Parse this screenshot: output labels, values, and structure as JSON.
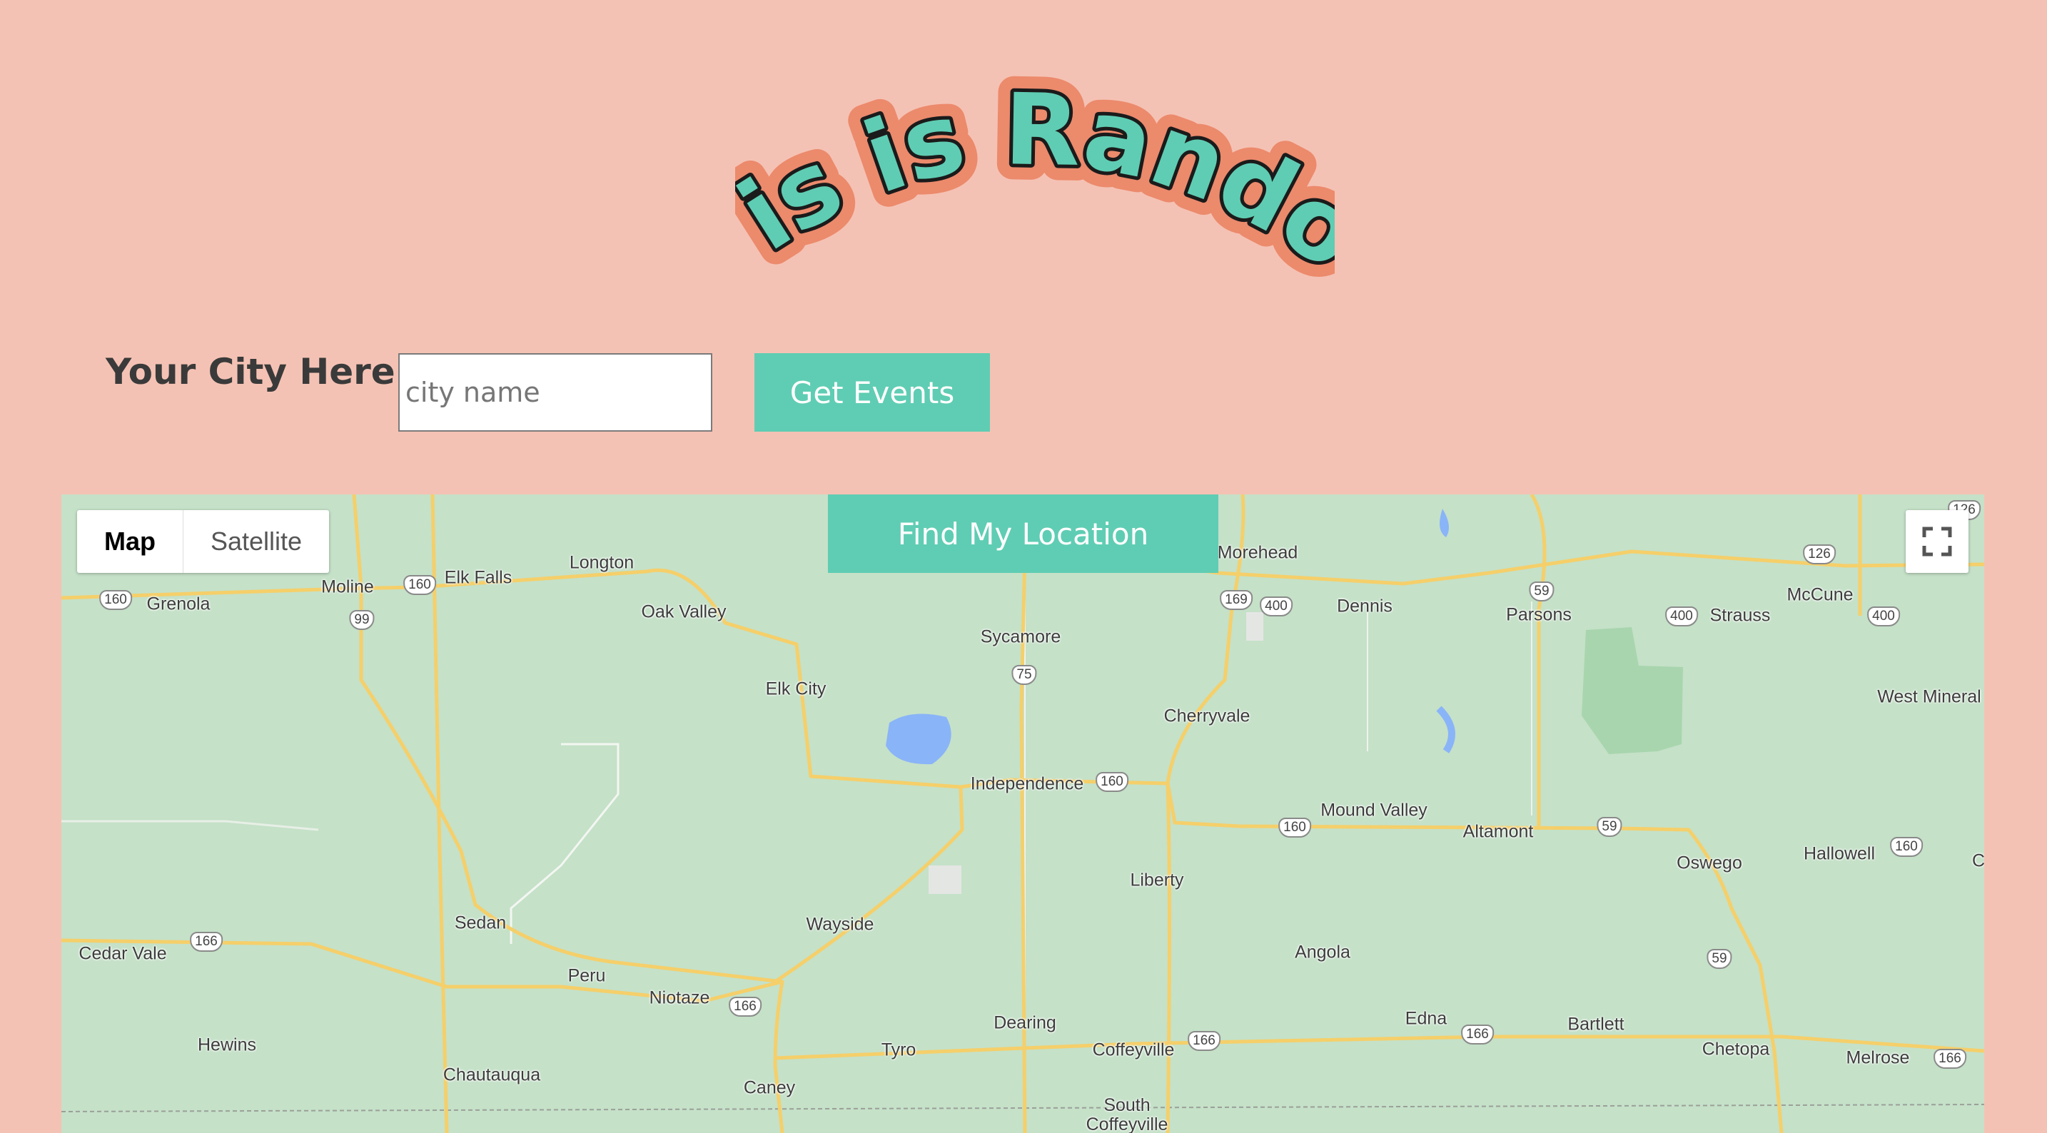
{
  "header": {
    "logo_text": "This is Random"
  },
  "search": {
    "label": "Your City Here:",
    "placeholder": "city name",
    "value": "",
    "submit_label": "Get Events"
  },
  "map": {
    "find_location_label": "Find My Location",
    "map_type_options": [
      "Map",
      "Satellite"
    ],
    "selected_map_type": "Map",
    "fullscreen_icon": "fullscreen-icon",
    "places": [
      "Longton",
      "Elk Falls",
      "Moline",
      "Grenola",
      "Oak Valley",
      "Morehead",
      "Dennis",
      "Parsons",
      "Strauss",
      "McCune",
      "Sycamore",
      "Elk City",
      "Cherryvale",
      "West Mineral",
      "Independence",
      "Mound Valley",
      "Altamont",
      "Oswego",
      "Hallowell",
      "Liberty",
      "Sedan",
      "Wayside",
      "Cedar Vale",
      "Angola",
      "Peru",
      "Niotaze",
      "Hewins",
      "Dearing",
      "Tyro",
      "Coffeyville",
      "Edna",
      "Bartlett",
      "Chetopa",
      "Melrose",
      "Chautauqua",
      "Caney",
      "South Coffeyville",
      "C"
    ],
    "route_shields": [
      "160",
      "160",
      "99",
      "169",
      "400",
      "59",
      "400",
      "400",
      "126",
      "126",
      "75",
      "160",
      "160",
      "59",
      "160",
      "166",
      "166",
      "59",
      "166",
      "166",
      "166"
    ]
  },
  "colors": {
    "background": "#f4c2b4",
    "accent": "#5fcdb3",
    "logo_outline": "#ec8a6c",
    "map_land": "#c5e1c8",
    "map_road": "#f5cf6a",
    "map_water": "#8ab4f8"
  }
}
